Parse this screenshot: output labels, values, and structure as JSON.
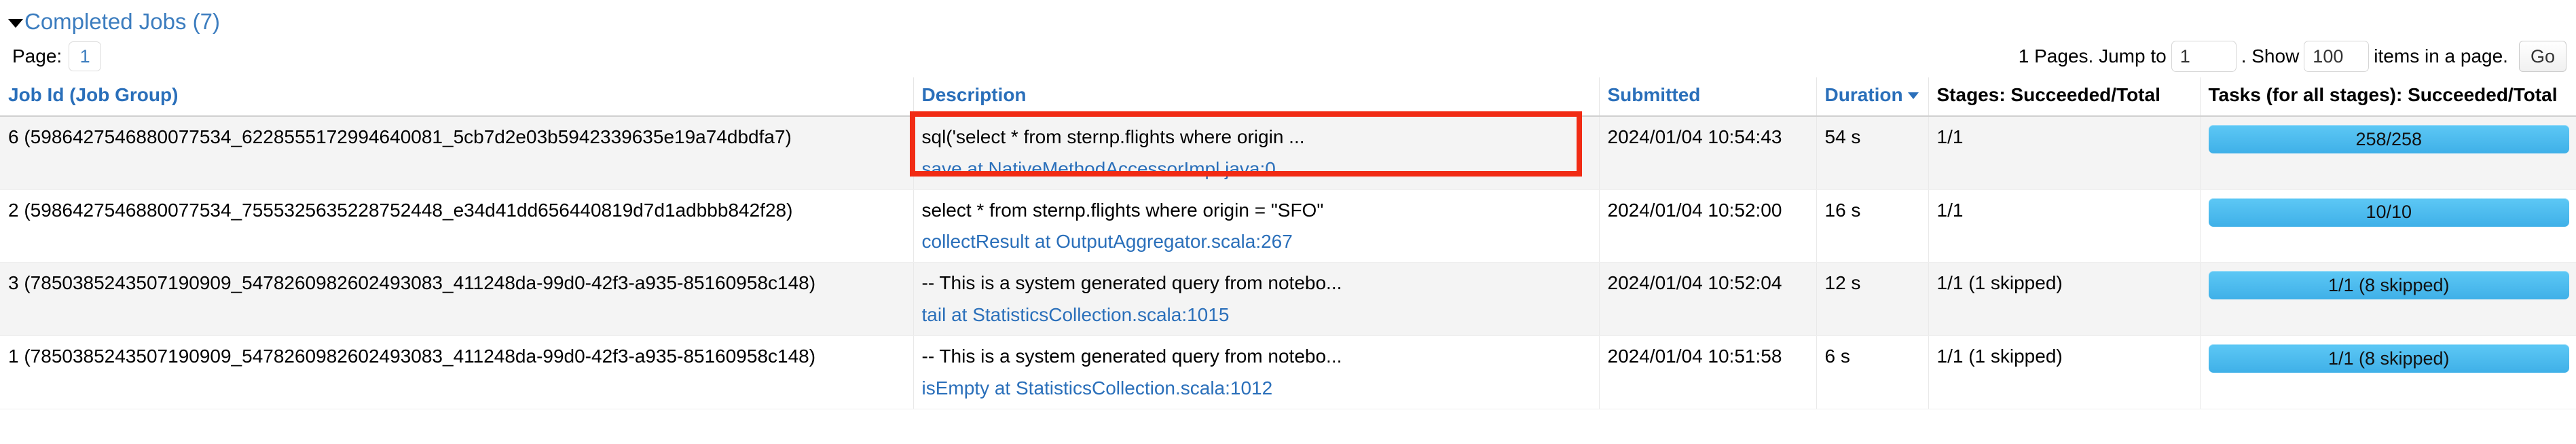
{
  "section": {
    "title": "Completed Jobs (7)",
    "collapse_icon": "caret-down-icon"
  },
  "pager": {
    "page_label": "Page:",
    "current_page": "1",
    "pages_prefix": "1 Pages. Jump to",
    "jump_value": "1",
    "show_label": ". Show",
    "show_value": "100",
    "items_suffix": "items in a page.",
    "go_label": "Go"
  },
  "table": {
    "columns": [
      "Job Id (Job Group)",
      "Description",
      "Submitted",
      "Duration",
      "Stages: Succeeded/Total",
      "Tasks (for all stages): Succeeded/Total"
    ],
    "sorted_column": "Duration",
    "sort_icon": "caret-down-icon",
    "rows": [
      {
        "job_id": "6 (5986427546880077534_6228555172994640081_5cb7d2e03b5942339635e19a74dbdfa7)",
        "description": "sql('select * from sternp.flights where origin ...",
        "description_link": "save at NativeMethodAccessorImpl.java:0",
        "submitted": "2024/01/04 10:54:43",
        "duration": "54 s",
        "stages": "1/1",
        "tasks": "258/258",
        "tasks_percent": 100,
        "highlighted": true
      },
      {
        "job_id": "2 (5986427546880077534_7555325635228752448_e34d41dd656440819d7d1adbbb842f28)",
        "description": "select * from sternp.flights where origin = \"SFO\"",
        "description_link": "collectResult at OutputAggregator.scala:267",
        "submitted": "2024/01/04 10:52:00",
        "duration": "16 s",
        "stages": "1/1",
        "tasks": "10/10",
        "tasks_percent": 100,
        "highlighted": false
      },
      {
        "job_id": "3 (7850385243507190909_5478260982602493083_411248da-99d0-42f3-a935-85160958c148)",
        "description": "-- This is a system generated query from notebo...",
        "description_link": "tail at StatisticsCollection.scala:1015",
        "submitted": "2024/01/04 10:52:04",
        "duration": "12 s",
        "stages": "1/1 (1 skipped)",
        "tasks": "1/1 (8 skipped)",
        "tasks_percent": 100,
        "highlighted": false
      },
      {
        "job_id": "1 (7850385243507190909_5478260982602493083_411248da-99d0-42f3-a935-85160958c148)",
        "description": "-- This is a system generated query from notebo...",
        "description_link": "isEmpty at StatisticsCollection.scala:1012",
        "submitted": "2024/01/04 10:51:58",
        "duration": "6 s",
        "stages": "1/1 (1 skipped)",
        "tasks": "1/1 (8 skipped)",
        "tasks_percent": 100,
        "highlighted": false
      }
    ]
  },
  "colors": {
    "link": "#2a6fba",
    "title": "#3c7dbf",
    "annotation": "#f12b14",
    "progress": "#4db9ec",
    "row_stripe": "#f4f4f4"
  }
}
